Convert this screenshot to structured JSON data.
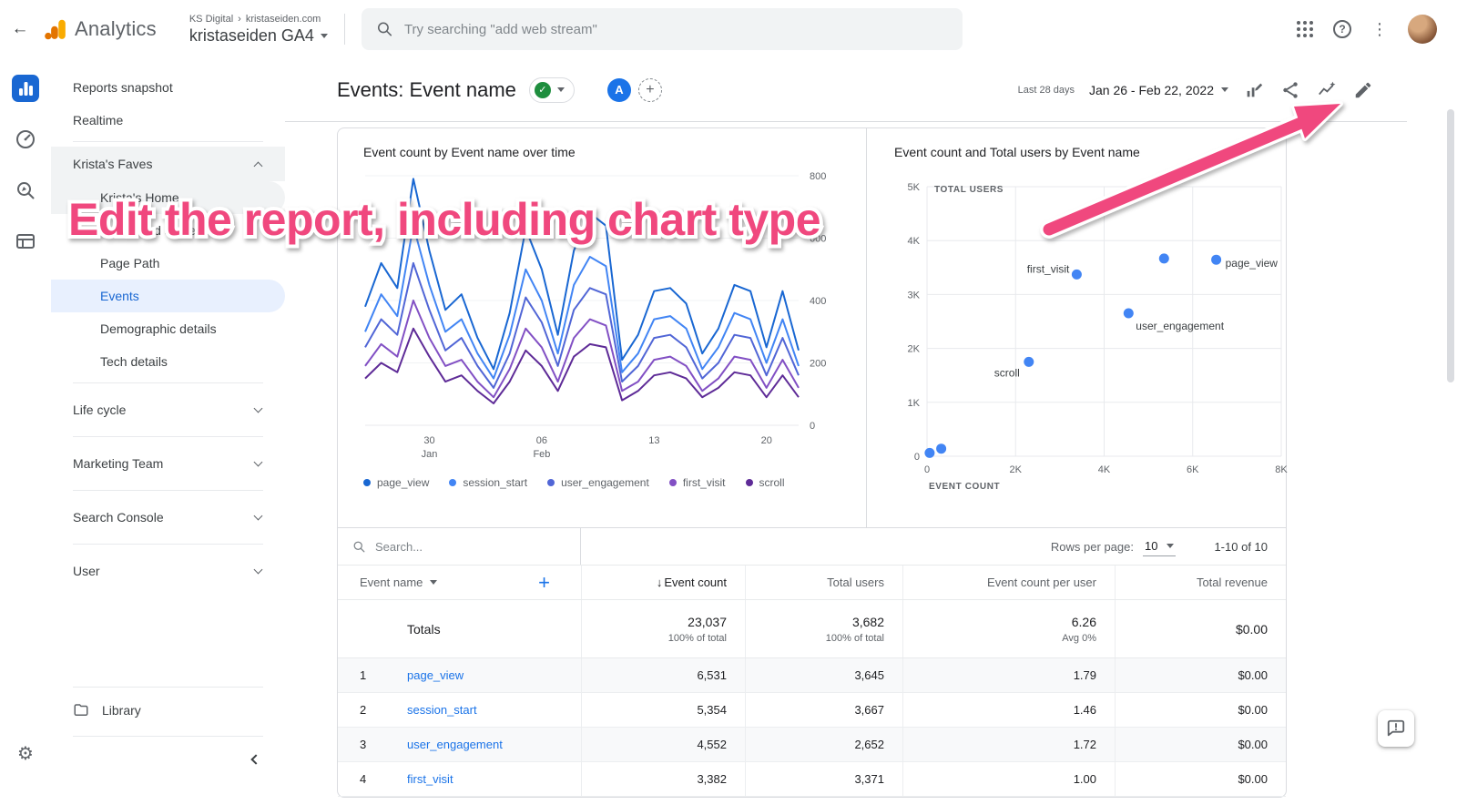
{
  "icons": {
    "back": "←",
    "breadcrumb_separator": "›",
    "help": "?",
    "more_vert": "⋮",
    "gear": "⚙",
    "plus": "+",
    "check": "✓",
    "sort_desc": "↓"
  },
  "topbar": {
    "brand": "Analytics",
    "breadcrumb": [
      "KS Digital",
      "kristaseiden.com"
    ],
    "account": "kristaseiden GA4",
    "search_placeholder": "Try searching \"add web stream\""
  },
  "sidebar": {
    "items": [
      "Reports snapshot",
      "Realtime"
    ],
    "faves": {
      "label": "Krista's Faves",
      "children": [
        "Krista's Home",
        "Pages and screens",
        "Page Path",
        "Events",
        "Demographic details",
        "Tech details"
      ],
      "selected": "Events"
    },
    "sections": [
      "Life cycle",
      "Marketing Team",
      "Search Console",
      "User"
    ],
    "library": "Library"
  },
  "report": {
    "title": "Events: Event name",
    "avatar_label": "A",
    "date_preset": "Last 28 days",
    "date_range": "Jan 26 - Feb 22, 2022"
  },
  "chart_data": [
    {
      "type": "line",
      "title": "Event count by Event name over time",
      "ylim": [
        0,
        800
      ],
      "yticks": [
        0,
        200,
        400,
        600,
        800
      ],
      "x_days": 28,
      "xticks": [
        {
          "pos": 4,
          "label": "30",
          "sub": "Jan"
        },
        {
          "pos": 11,
          "label": "06",
          "sub": "Feb"
        },
        {
          "pos": 18,
          "label": "13",
          "sub": ""
        },
        {
          "pos": 25,
          "label": "20",
          "sub": ""
        }
      ],
      "series": [
        {
          "name": "page_view",
          "color": "#1967d2",
          "values": [
            380,
            520,
            440,
            790,
            560,
            370,
            420,
            280,
            180,
            360,
            630,
            500,
            290,
            560,
            680,
            640,
            210,
            290,
            430,
            440,
            390,
            230,
            310,
            450,
            430,
            250,
            430,
            240
          ]
        },
        {
          "name": "session_start",
          "color": "#4285f4",
          "values": [
            300,
            420,
            350,
            640,
            450,
            300,
            340,
            230,
            150,
            290,
            500,
            400,
            230,
            450,
            540,
            510,
            170,
            230,
            340,
            350,
            310,
            180,
            250,
            360,
            340,
            200,
            340,
            190
          ]
        },
        {
          "name": "user_engagement",
          "color": "#5166d6",
          "values": [
            250,
            340,
            290,
            520,
            370,
            240,
            280,
            190,
            120,
            230,
            410,
            330,
            190,
            370,
            440,
            420,
            140,
            190,
            280,
            290,
            250,
            150,
            200,
            290,
            280,
            160,
            280,
            160
          ]
        },
        {
          "name": "first_visit",
          "color": "#8250c4",
          "values": [
            190,
            260,
            220,
            400,
            280,
            190,
            210,
            140,
            90,
            180,
            310,
            250,
            140,
            280,
            340,
            320,
            110,
            140,
            210,
            220,
            190,
            110,
            150,
            220,
            210,
            120,
            210,
            120
          ]
        },
        {
          "name": "scroll",
          "color": "#5e2b97",
          "values": [
            150,
            200,
            170,
            310,
            220,
            140,
            160,
            110,
            70,
            140,
            240,
            190,
            110,
            220,
            260,
            250,
            80,
            110,
            160,
            170,
            150,
            90,
            120,
            170,
            160,
            90,
            160,
            90
          ]
        }
      ]
    },
    {
      "type": "scatter",
      "title": "Event count and Total users by Event name",
      "xlabel": "EVENT COUNT",
      "ylabel": "TOTAL USERS",
      "xlim": [
        0,
        8000
      ],
      "ylim": [
        0,
        5000
      ],
      "xticks": [
        "0",
        "2K",
        "4K",
        "6K",
        "8K"
      ],
      "yticks": [
        "0",
        "1K",
        "2K",
        "3K",
        "4K",
        "5K"
      ],
      "point_color": "#4285f4",
      "points": [
        {
          "name": "page_view",
          "x": 6531,
          "y": 3645,
          "label": true,
          "anchor": "start",
          "dx": 10,
          "dy": 4
        },
        {
          "name": "session_start",
          "x": 5354,
          "y": 3667,
          "label": false
        },
        {
          "name": "user_engagement",
          "x": 4552,
          "y": 2652,
          "label": true,
          "anchor": "start",
          "dx": 8,
          "dy": 14
        },
        {
          "name": "first_visit",
          "x": 3382,
          "y": 3371,
          "label": true,
          "anchor": "end",
          "dx": -8,
          "dy": -6
        },
        {
          "name": "scroll",
          "x": 2300,
          "y": 1750,
          "label": true,
          "anchor": "end",
          "dx": -10,
          "dy": 12
        },
        {
          "name": "",
          "x": 60,
          "y": 60,
          "label": false
        },
        {
          "name": "",
          "x": 320,
          "y": 140,
          "label": false
        }
      ]
    }
  ],
  "table": {
    "search_placeholder": "Search...",
    "rows_per_page_label": "Rows per page:",
    "rows_per_page": "10",
    "pagination": "1-10 of 10",
    "dimension_column": "Event name",
    "columns": [
      "Event count",
      "Total users",
      "Event count per user",
      "Total revenue"
    ],
    "totals_label": "Totals",
    "totals": {
      "event_count": "23,037",
      "event_count_sub": "100% of total",
      "total_users": "3,682",
      "total_users_sub": "100% of total",
      "per_user": "6.26",
      "per_user_sub": "Avg 0%",
      "revenue": "$0.00"
    },
    "rows": [
      {
        "index": "1",
        "name": "page_view",
        "event_count": "6,531",
        "total_users": "3,645",
        "per_user": "1.79",
        "revenue": "$0.00"
      },
      {
        "index": "2",
        "name": "session_start",
        "event_count": "5,354",
        "total_users": "3,667",
        "per_user": "1.46",
        "revenue": "$0.00"
      },
      {
        "index": "3",
        "name": "user_engagement",
        "event_count": "4,552",
        "total_users": "2,652",
        "per_user": "1.72",
        "revenue": "$0.00"
      },
      {
        "index": "4",
        "name": "first_visit",
        "event_count": "3,382",
        "total_users": "3,371",
        "per_user": "1.00",
        "revenue": "$0.00"
      }
    ]
  },
  "annotation": {
    "text": "Edit  the report, including chart type",
    "color": "#f0487e"
  }
}
